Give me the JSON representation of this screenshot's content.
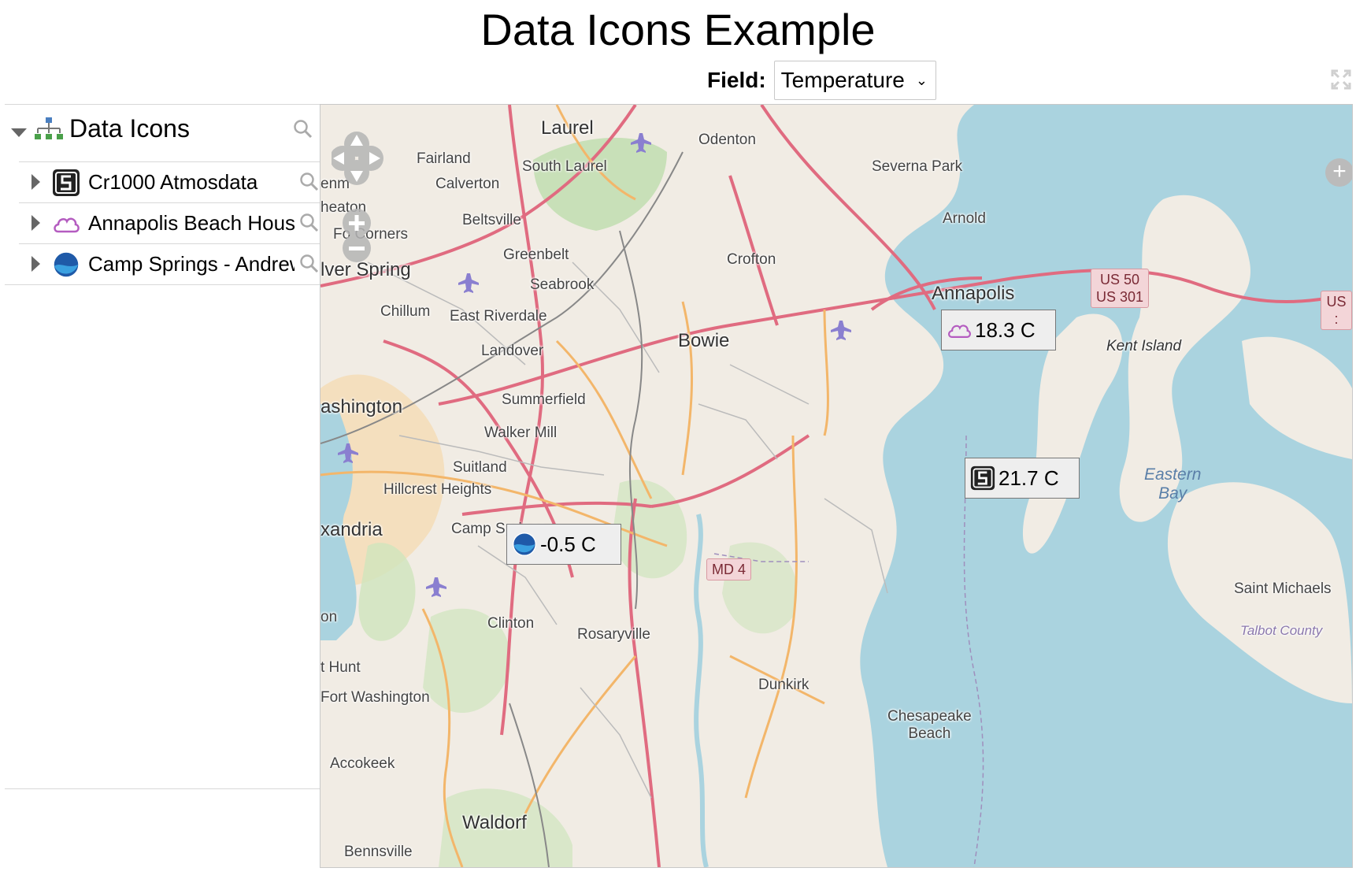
{
  "page": {
    "title": "Data Icons Example"
  },
  "field": {
    "label": "Field:",
    "selected": "Temperature"
  },
  "sidebar": {
    "root_label": "Data Icons",
    "items": [
      {
        "label": "Cr1000 Atmosdata",
        "icon": "campbell-logo-icon"
      },
      {
        "label": "Annapolis Beach House",
        "icon": "cloud-icon"
      },
      {
        "label": "Camp Springs - Andrews",
        "icon": "noaa-icon"
      }
    ]
  },
  "map": {
    "places": {
      "laurel": "Laurel",
      "odenton": "Odenton",
      "fairland": "Fairland",
      "south_laurel": "South Laurel",
      "calverton": "Calverton",
      "severna_park": "Severna Park",
      "beltsville": "Beltsville",
      "arnold": "Arnold",
      "fo_corners": "Fo Corners",
      "greenbelt": "Greenbelt",
      "crofton": "Crofton",
      "silver_spring": "lver Spring",
      "seabrook": "Seabrook",
      "annapolis": "Annapolis",
      "chillum": "Chillum",
      "east_riverdale": "East Riverdale",
      "bowie": "Bowie",
      "landover": "Landover",
      "kent_island": "Kent Island",
      "washington": "ashington",
      "summerfield": "Summerfield",
      "walker_mill": "Walker Mill",
      "suitland": "Suitland",
      "hillcrest_heights": "Hillcrest Heights",
      "alexandria": "xandria",
      "camp_springs": "Camp Springs",
      "clinton": "Clinton",
      "rosaryville": "Rosaryville",
      "saint_michaels": "Saint Michaels",
      "fort_hunt": "t Hunt",
      "fort_washington": "Fort Washington",
      "dunkirk": "Dunkirk",
      "chesapeake_beach": "Chesapeake\nBeach",
      "accokeek": "Accokeek",
      "waldorf": "Waldorf",
      "bennsville": "Bennsville",
      "eastern_bay": "Eastern\nBay",
      "talbot_county": "Talbot County",
      "enm": "enm",
      "heaton": "heaton",
      "on": "on"
    },
    "shields": {
      "us50": "US 50\nUS 301",
      "md4": "MD 4",
      "us_edge": "US :"
    },
    "readings": [
      {
        "station": "Annapolis Beach House",
        "icon": "cloud-icon",
        "value": "18.3 C"
      },
      {
        "station": "Cr1000 Atmosdata",
        "icon": "campbell-logo-icon",
        "value": "21.7 C"
      },
      {
        "station": "Camp Springs - Andrews",
        "icon": "noaa-icon",
        "value": "-0.5 C"
      }
    ]
  },
  "colors": {
    "water": "#aad3df",
    "land": "#f1ece4",
    "park": "#c8e0b8",
    "urban": "#f5dcb4",
    "road_major": "#e06b80",
    "road_minor": "#f3b66a"
  }
}
